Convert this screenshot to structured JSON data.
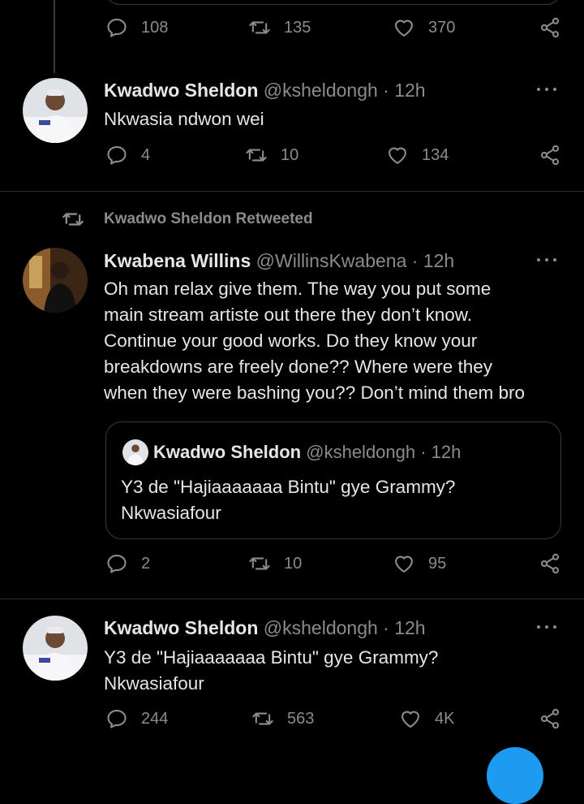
{
  "tweets": [
    {
      "counts": {
        "replies": "108",
        "retweets": "135",
        "likes": "370"
      }
    },
    {
      "name": "Kwadwo Sheldon",
      "handle": "@ksheldongh · 12h",
      "lines": [
        "Nkwasia ndwon wei"
      ],
      "counts": {
        "replies": "4",
        "retweets": "10",
        "likes": "134"
      }
    },
    {
      "retweeted_by": "Kwadwo Sheldon Retweeted",
      "name": "Kwabena Willins",
      "handle": "@WillinsKwabena · 12h",
      "lines": [
        "Oh man relax give them. The way you put some",
        "main stream artiste out there they don’t know.",
        "Continue your good works. Do they know your",
        "breakdowns are freely done?? Where were they",
        "when they were bashing you?? Don’t mind them bro"
      ],
      "quote": {
        "name": "Kwadwo Sheldon",
        "handle": "@ksheldongh · 12h",
        "lines": [
          "Y3 de \"Hajiaaaaaaa Bintu\" gye Grammy?",
          "Nkwasiafour"
        ]
      },
      "counts": {
        "replies": "2",
        "retweets": "10",
        "likes": "95"
      }
    },
    {
      "name": "Kwadwo Sheldon",
      "handle": "@ksheldongh · 12h",
      "lines": [
        "Y3 de \"Hajiaaaaaaa Bintu\" gye Grammy?",
        "Nkwasiafour"
      ],
      "counts": {
        "replies": "244",
        "retweets": "563",
        "likes": "4K"
      }
    }
  ],
  "colors": {
    "background": "#000000",
    "text": "#e6e6e6",
    "muted": "#8b8b8b",
    "accent": "#1d9bf0"
  }
}
